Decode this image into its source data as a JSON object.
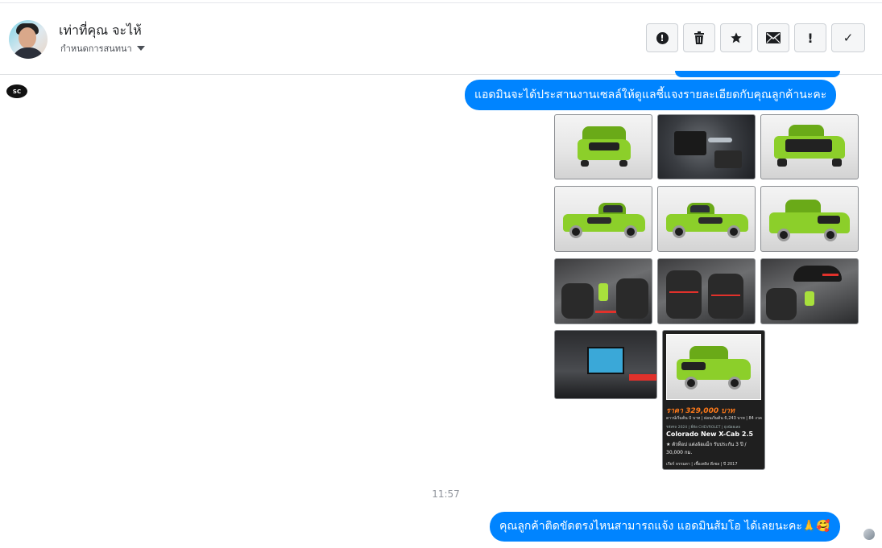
{
  "header": {
    "name": "เท่าที่คุณ จะไห้",
    "subtitle": "กำหนดการสนทนา"
  },
  "actions": [
    {
      "icon": "alert-circle-icon"
    },
    {
      "icon": "trash-icon"
    },
    {
      "icon": "star-icon"
    },
    {
      "icon": "envelope-icon"
    },
    {
      "icon": "exclamation-icon",
      "label": "!"
    },
    {
      "icon": "checkmark-icon",
      "label": "✓"
    }
  ],
  "page_logo": "SC",
  "messages": {
    "msg1": "แอดมินจะได้ประสานงานเซลล์ให้ดูแลชี้แจงรายละเอียดกับคุณลูกค้านะคะ",
    "timestamp": "11:57",
    "msg2": "คุณลูกค้าติดขัดตรงไหนสามารถแจ้ง แอดมินส้มโอ ได้เลยนะคะ🙏🥰"
  },
  "promo_card": {
    "price": "ราคา 329,000 บาท",
    "terms": "ดาวน์เริ่มต้น 0 บาท | ผ่อนเริ่มต้น 6,243 บาท | 84 งวด",
    "tags": "รหัสรถ 2024 | ยี่ห้อ CHEVROLET | ยุ่งน้อยเลย",
    "model": "Colorado New X-Cab 2.5",
    "desc": "★ ตัวท็อป แต่งล้อแม็ก รับประกัน 3 ปี / 30,000 กม.",
    "foot": "เกียร์ ธรรมดา | เชื้อเพลิง ดีเซล | ปี 2017"
  },
  "colors": {
    "bubble": "#0084ff",
    "car_green": "#8ccf2a",
    "price_orange": "#ff7a1a"
  }
}
